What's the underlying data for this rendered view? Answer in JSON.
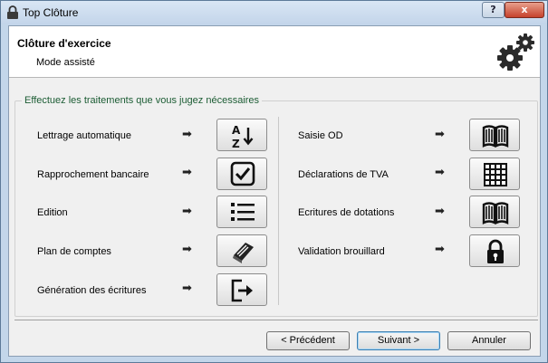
{
  "window": {
    "title": "Top Clôture",
    "help_label": "?",
    "close_label": "x"
  },
  "header": {
    "title": "Clôture d'exercice",
    "subtitle": "Mode assisté"
  },
  "group": {
    "label": "Effectuez les traitements que vous jugez nécessaires"
  },
  "left_actions": [
    {
      "label": "Lettrage automatique",
      "icon": "sort-az-icon"
    },
    {
      "label": "Rapprochement bancaire",
      "icon": "checkbox-icon"
    },
    {
      "label": "Edition",
      "icon": "list-icon"
    },
    {
      "label": "Plan de comptes",
      "icon": "book-icon"
    },
    {
      "label": "Génération des écritures",
      "icon": "export-icon"
    }
  ],
  "right_actions": [
    {
      "label": "Saisie OD",
      "icon": "open-book-icon"
    },
    {
      "label": "Déclarations de TVA",
      "icon": "grid-icon"
    },
    {
      "label": "Ecritures de dotations",
      "icon": "open-book-icon"
    },
    {
      "label": "Validation brouillard",
      "icon": "padlock-icon"
    }
  ],
  "arrow_glyph": "➡",
  "buttons": {
    "previous": "< Précédent",
    "next": "Suivant >",
    "cancel": "Annuler"
  }
}
